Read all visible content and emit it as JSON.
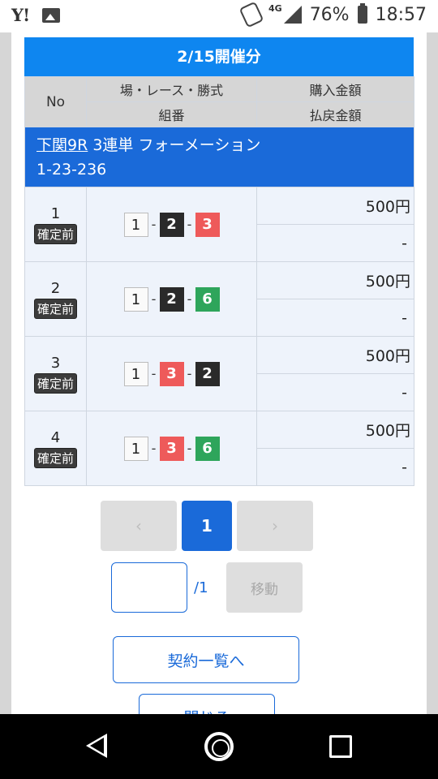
{
  "status_bar": {
    "left_icons": [
      "yahoo-icon",
      "image-icon"
    ],
    "yahoo_text": "Y!",
    "network_label": "4G",
    "battery_percent": "76%",
    "time": "18:57"
  },
  "modal": {
    "heading": "2/15開催分",
    "table_headers": {
      "no": "No",
      "venue_race_type": "場・レース・勝式",
      "combination": "組番",
      "purchase_amount": "購入金額",
      "payout_amount": "払戻金額"
    },
    "race": {
      "venue_race": "下関9R",
      "bet_type": "3連単 フォーメーション",
      "formation": "1-23-236"
    },
    "rows": [
      {
        "no": "1",
        "status": "確定前",
        "combo": [
          {
            "n": "1",
            "c": "c1"
          },
          {
            "n": "2",
            "c": "c2"
          },
          {
            "n": "3",
            "c": "c3"
          }
        ],
        "purchase": "500円",
        "payout": "-"
      },
      {
        "no": "2",
        "status": "確定前",
        "combo": [
          {
            "n": "1",
            "c": "c1"
          },
          {
            "n": "2",
            "c": "c2"
          },
          {
            "n": "6",
            "c": "c6"
          }
        ],
        "purchase": "500円",
        "payout": "-"
      },
      {
        "no": "3",
        "status": "確定前",
        "combo": [
          {
            "n": "1",
            "c": "c1"
          },
          {
            "n": "3",
            "c": "c3"
          },
          {
            "n": "2",
            "c": "c2"
          }
        ],
        "purchase": "500円",
        "payout": "-"
      },
      {
        "no": "4",
        "status": "確定前",
        "combo": [
          {
            "n": "1",
            "c": "c1"
          },
          {
            "n": "3",
            "c": "c3"
          },
          {
            "n": "6",
            "c": "c6"
          }
        ],
        "purchase": "500円",
        "payout": "-"
      }
    ],
    "combo_separator": "-",
    "pagination": {
      "prev_label": "‹",
      "current_page": "1",
      "next_label": "›"
    },
    "page_jump": {
      "input_value": "",
      "total_label": "/1",
      "move_label": "移動"
    },
    "buttons": {
      "contract_list": "契約一覧へ",
      "close": "閉じる"
    }
  },
  "colors": {
    "heading_blue": "#0e86f0",
    "race_bar_blue": "#1a6ad9",
    "boat_1": "#fafafa",
    "boat_2": "#2a2a2a",
    "boat_3": "#ee5a5a",
    "boat_6": "#2ea55b"
  },
  "nav_bar": {
    "icons": [
      "back-icon",
      "home-icon",
      "recent-apps-icon"
    ]
  }
}
